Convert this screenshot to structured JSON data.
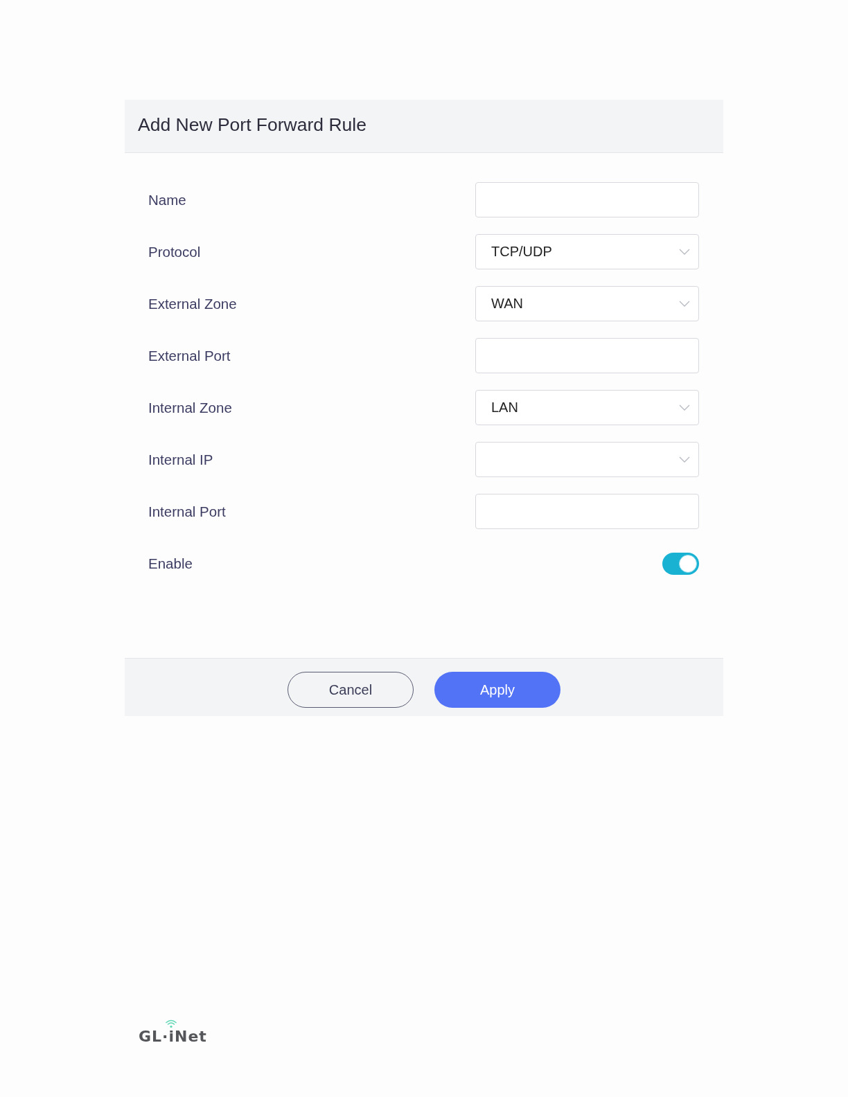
{
  "dialog": {
    "title": "Add New Port Forward Rule"
  },
  "fields": [
    {
      "label": "Name",
      "kind": "input"
    },
    {
      "label": "Protocol",
      "kind": "select",
      "value": "TCP/UDP"
    },
    {
      "label": "External Zone",
      "kind": "select",
      "value": "WAN"
    },
    {
      "label": "External Port",
      "kind": "input"
    },
    {
      "label": "Internal Zone",
      "kind": "select",
      "value": "LAN"
    },
    {
      "label": "Internal IP",
      "kind": "select"
    },
    {
      "label": "Internal Port",
      "kind": "input"
    },
    {
      "label": "Enable",
      "kind": "switch",
      "on": true
    }
  ],
  "buttons": [
    {
      "label": "Cancel",
      "kind": "secondary"
    },
    {
      "label": "Apply",
      "kind": "primary"
    }
  ],
  "logo": {
    "text": "GL·iNet"
  }
}
